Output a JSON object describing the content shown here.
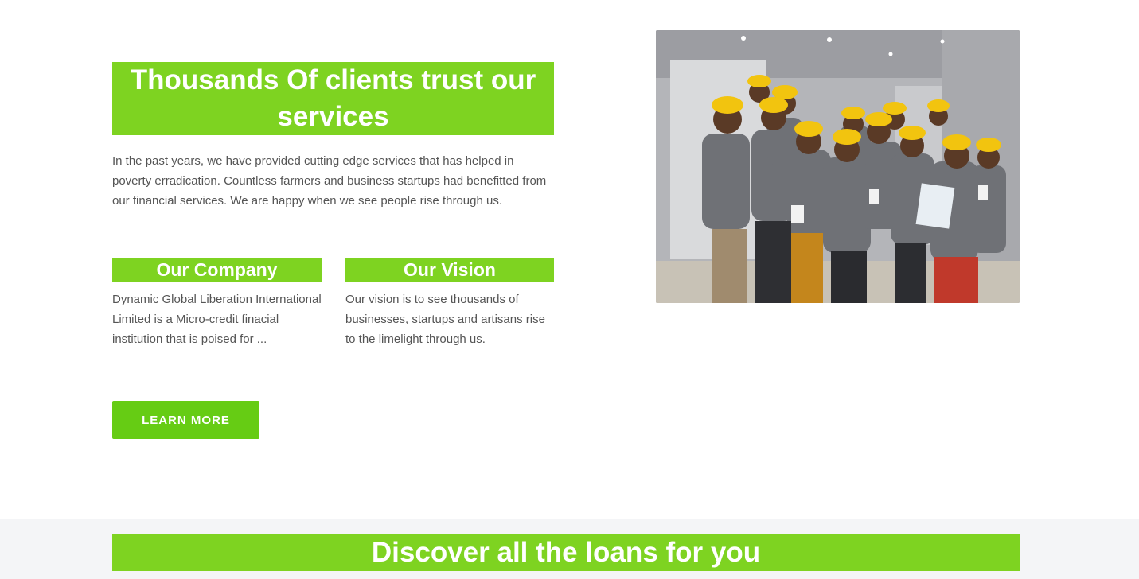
{
  "about": {
    "title": "Thousands Of clients trust our services",
    "intro": "In the past years, we have provided cutting edge services that has helped in poverty erradication. Countless farmers and business startups had benefitted from our financial services. We are happy when we see people rise through us.",
    "company": {
      "heading": "Our Company",
      "text": "Dynamic Global Liberation International Limited is a Micro-credit finacial institution that is poised for ..."
    },
    "vision": {
      "heading": "Our Vision",
      "text": "Our vision is to see thousands of businesses, startups and artisans rise to the limelight through us."
    },
    "cta_label": "LEARN MORE"
  },
  "loans": {
    "title": "Discover all the loans for you"
  },
  "colors": {
    "accent": "#7ed321",
    "button": "#66cc14",
    "text": "#555555",
    "band": "#f4f5f7"
  }
}
